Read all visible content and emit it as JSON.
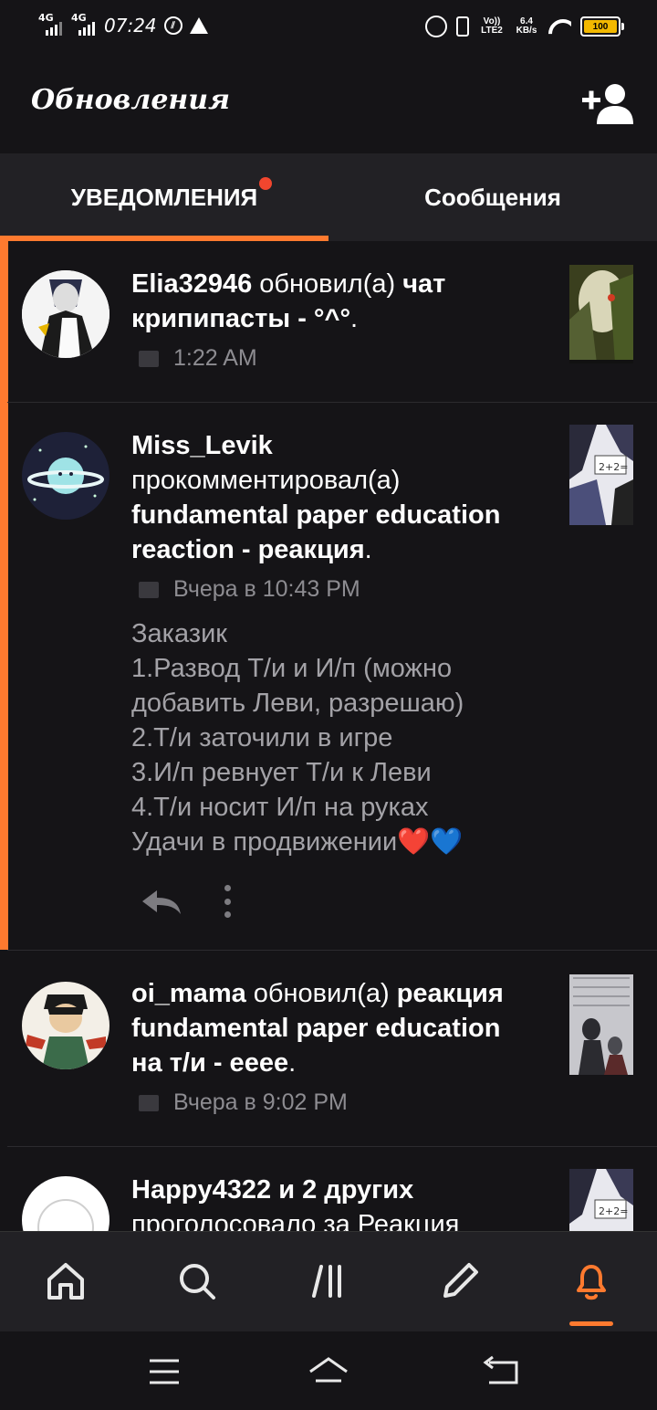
{
  "status_bar": {
    "time": "07:24",
    "net1": "4G",
    "net2": "4G",
    "volte": "Vo)) LTE2",
    "speed": "6.4 KB/s",
    "battery": "100"
  },
  "header": {
    "title": "Обновления"
  },
  "tabs": [
    {
      "label": "УВЕДОМЛЕНИЯ",
      "active": true,
      "has_dot": true
    },
    {
      "label": "Сообщения",
      "active": false
    }
  ],
  "colors": {
    "accent": "#ff7a2f",
    "dot": "#f2462e",
    "background": "#151417",
    "bar": "#222125",
    "muted": "#8d8c91"
  },
  "feed": [
    {
      "user": "Elia32946",
      "action": " обновил(а) ",
      "target": "чат крипипасты - °^°",
      "end": ".",
      "time": "1:22 AM",
      "unread": true,
      "icon": "book-icon"
    },
    {
      "user": "Miss_Levik",
      "action": " прокомментировал(а) ",
      "target": "fundamental paper education reaction - реакция",
      "end": ".",
      "time": "Вчера в 10:43 PM",
      "unread": true,
      "icon": "comment-icon",
      "comment": "Заказик\n1.Развод Т/и и И/п (можно добавить Леви, разрешаю)\n2.Т/и заточили в игре\n3.И/п ревнует Т/и к Леви\n4.Т/и носит И/п на руках\nУдачи в продвижении❤️💙"
    },
    {
      "user": "oi_mama",
      "action": " обновил(а) ",
      "target": "реакция fundamental paper education на т/и - eeee",
      "end": ".",
      "time": "Вчера в 9:02 PM",
      "unread": false,
      "icon": "book-icon"
    },
    {
      "user": "Happy4322",
      "action": " ",
      "target": "и 2 других",
      "end": "",
      "unread": false,
      "partial_text": "проголосовало за Реакция"
    }
  ],
  "bottom_nav": [
    {
      "name": "home-icon"
    },
    {
      "name": "search-icon"
    },
    {
      "name": "library-icon"
    },
    {
      "name": "pencil-icon"
    },
    {
      "name": "bell-icon",
      "active": true
    }
  ]
}
